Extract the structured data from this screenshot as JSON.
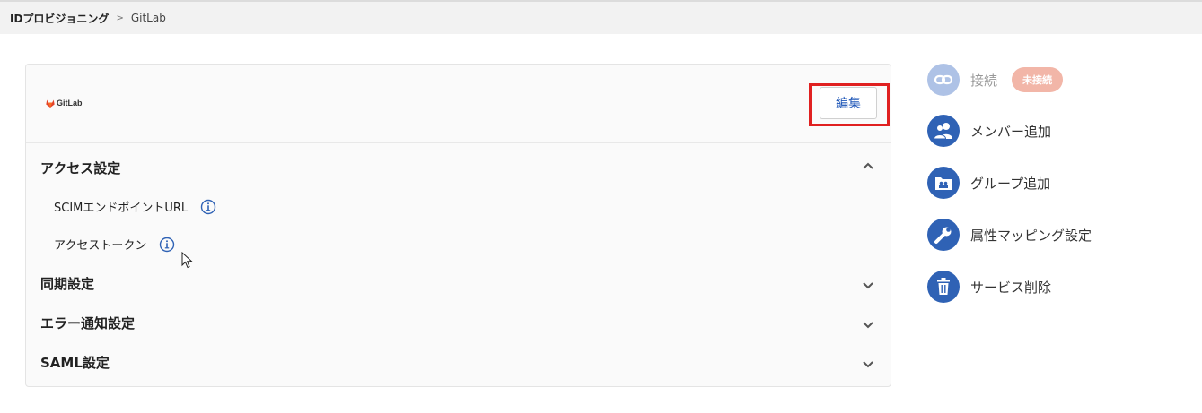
{
  "breadcrumb": {
    "root": "IDプロビジョニング",
    "separator": ">",
    "current": "GitLab"
  },
  "card": {
    "logo_text": "GitLab",
    "edit_label": "編集",
    "sections": [
      {
        "title": "アクセス設定",
        "expanded": true,
        "items": [
          {
            "label": "SCIMエンドポイントURL"
          },
          {
            "label": "アクセストークン"
          }
        ]
      },
      {
        "title": "同期設定",
        "expanded": false
      },
      {
        "title": "エラー通知設定",
        "expanded": false
      },
      {
        "title": "SAML設定",
        "expanded": false
      }
    ]
  },
  "sidebar": {
    "items": [
      {
        "label": "接続",
        "icon": "link-icon",
        "badge": "未接続",
        "disabled": true
      },
      {
        "label": "メンバー追加",
        "icon": "users-icon"
      },
      {
        "label": "グループ追加",
        "icon": "group-folder-icon"
      },
      {
        "label": "属性マッピング設定",
        "icon": "wrench-icon"
      },
      {
        "label": "サービス削除",
        "icon": "trash-icon"
      }
    ]
  },
  "colors": {
    "accent": "#2f62b5",
    "highlight": "#e02020",
    "badge": "#f2b6a8"
  }
}
